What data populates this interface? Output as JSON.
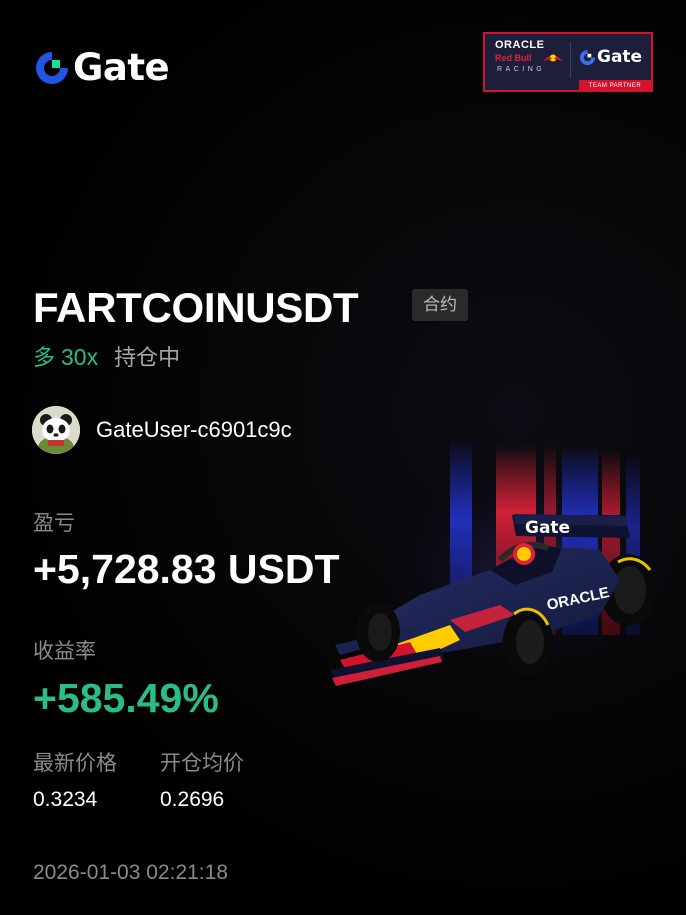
{
  "brand": {
    "name": "Gate",
    "accent_color": "#2354e6",
    "green_color": "#17e0a0"
  },
  "partner_badge": {
    "line1": "ORACLE",
    "line2": "Red Bull",
    "line3": "RACING",
    "brand": "Gate",
    "strip": "TEAM PARTNER",
    "border_color": "#d3122b"
  },
  "position": {
    "symbol": "FARTCOINUSDT",
    "tag": "合约",
    "side": "多",
    "leverage": "30x",
    "status": "持仓中"
  },
  "user": {
    "name": "GateUser-c6901c9c",
    "avatar_icon": "panda-avatar-icon"
  },
  "pnl": {
    "label": "盈亏",
    "value": "+5,728.83 USDT"
  },
  "roe": {
    "label": "收益率",
    "value": "+585.49%"
  },
  "prices": {
    "last_label": "最新价格",
    "last_value": "0.3234",
    "entry_label": "开仓均价",
    "entry_value": "0.2696"
  },
  "timestamp": "2026-01-03 02:21:18",
  "colors": {
    "profit_green": "#2bbd85",
    "muted_text": "#8a8a8a",
    "background": "#000000"
  }
}
